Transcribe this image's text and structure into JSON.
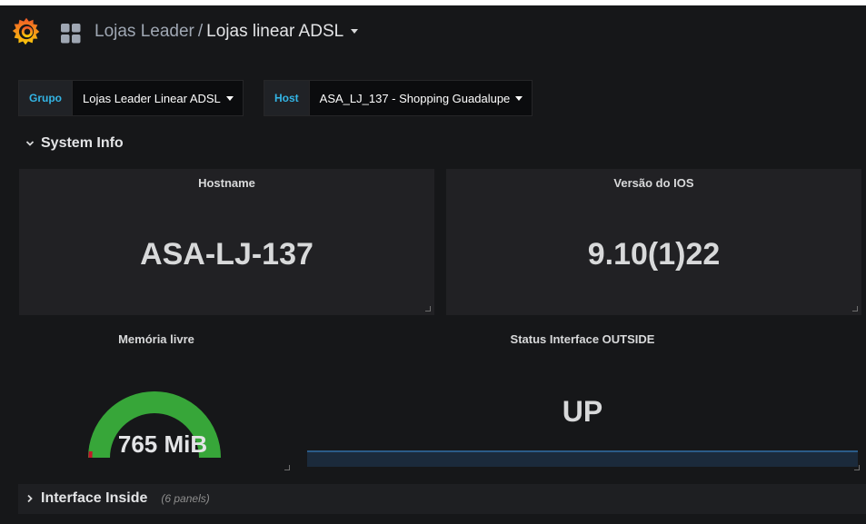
{
  "navbar": {
    "logo_icon": "grafana-logo-icon",
    "dashboards_icon": "dashboard-grid-icon",
    "breadcrumb_parent": "Lojas Leader",
    "breadcrumb_separator": "/",
    "breadcrumb_current": "Lojas linear ADSL"
  },
  "variables": [
    {
      "label": "Grupo",
      "value": "Lojas Leader Linear ADSL"
    },
    {
      "label": "Host",
      "value": "ASA_LJ_137 - Shopping Guadalupe"
    }
  ],
  "rows": {
    "system_info": {
      "title": "System Info",
      "expanded": true
    },
    "interface_inside": {
      "title": "Interface Inside",
      "panel_count": "(6 panels)",
      "expanded": false
    }
  },
  "panels": {
    "hostname": {
      "title": "Hostname",
      "value": "ASA-LJ-137"
    },
    "ios_version": {
      "title": "Versão do IOS",
      "value": "9.10(1)22"
    },
    "free_memory": {
      "title": "Memória livre",
      "value": "765 MiB",
      "fill_fraction": 1.0,
      "colors": {
        "fill": "#37a639",
        "threshold_low": "#c4162a",
        "outline": "#37a639"
      }
    },
    "status_outside": {
      "title": "Status Interface OUTSIDE",
      "value": "UP",
      "sparkline_color": "#2b5b88"
    }
  },
  "colors": {
    "background": "#161719",
    "panel": "#212124",
    "variable_label": "#33b5e5",
    "accent_orange": "#f05a28"
  }
}
